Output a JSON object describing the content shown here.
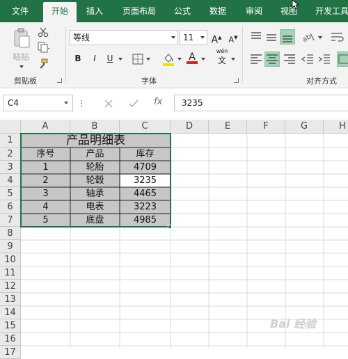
{
  "tabs": [
    "文件",
    "开始",
    "插入",
    "页面布局",
    "公式",
    "数据",
    "审阅",
    "视图",
    "开发工具"
  ],
  "ribbon": {
    "clipboard": {
      "paste_label": "粘贴",
      "group_label": "剪贴板"
    },
    "font": {
      "font_name": "等线",
      "font_size": "11",
      "bold": "B",
      "italic": "I",
      "underline": "U",
      "increase_size": "A",
      "decrease_size": "A",
      "phonetic_top": "wén",
      "phonetic_bottom": "文",
      "font_color_glyph": "A",
      "group_label": "字体",
      "fill_color": "#f0e000",
      "font_color": "#e02020"
    },
    "alignment": {
      "group_label": "对齐方式"
    }
  },
  "formula_bar": {
    "name_box": "C4",
    "fx": "fx",
    "value": "3235"
  },
  "grid": {
    "columns": [
      "A",
      "B",
      "C",
      "D",
      "E",
      "F",
      "G",
      "H"
    ],
    "rows": [
      "1",
      "2",
      "3",
      "4",
      "5",
      "6",
      "7",
      "8",
      "9",
      "10",
      "11",
      "12",
      "13",
      "14",
      "15",
      "16",
      "17"
    ],
    "title": "产品明细表",
    "headers": [
      "序号",
      "产品",
      "库存"
    ],
    "data": [
      [
        "1",
        "轮胎",
        "4709"
      ],
      [
        "2",
        "轮毂",
        "3235"
      ],
      [
        "3",
        "轴承",
        "4465"
      ],
      [
        "4",
        "电表",
        "3223"
      ],
      [
        "5",
        "底盘",
        "4985"
      ]
    ]
  },
  "watermark": "Bai 经验"
}
